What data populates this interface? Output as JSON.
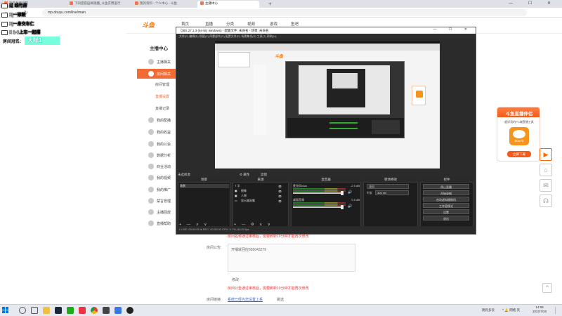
{
  "browser": {
    "tabs": [
      {
        "label": "万斤有悠行院"
      },
      {
        "label": "下同度容园闻观播_斗鱼实用鉴行"
      },
      {
        "label": "我的资料 - 个人中心 - 斗鱼"
      },
      {
        "label": "主播中心"
      }
    ],
    "url": "mp.douyu.com/live/main"
  },
  "overlay": {
    "lines": [
      "过  线竹房",
      "X|一修鼓",
      "X|一身交车仁",
      "X 1-1上车一起摆"
    ],
    "room_label": "房间冠名:",
    "room_value": "大咩1"
  },
  "douyu": {
    "logo": "斗鱼",
    "nav": [
      "首页",
      "直播",
      "分类",
      "视频",
      "游戏",
      "鱼吧"
    ],
    "sidebar_title": "主播中心",
    "sidebar_items": [
      "主播相关",
      "房间相关",
      "我的配播",
      "我的收益",
      "我的公会",
      "数据分析",
      "商业活动",
      "我的视频",
      "我的推广",
      "禁言管理",
      "主播回放",
      "直播帮助"
    ],
    "sidebar_subs": [
      "房间管理",
      "直播设置",
      "直播记录"
    ],
    "content": {
      "warn1": "房间名称通过审核后，需要刷新10分钟才能再次修改",
      "announce_label": "房间公告:",
      "announce_value": "开播就回应655043279",
      "modify": "修改",
      "warn2": "房间公告通过审核后，需要刷新10分钟才能再次修改",
      "loc_label": "房间链接:",
      "loc_value": "系统已经为您设置上系",
      "loc_action": "跳选"
    }
  },
  "ad": {
    "title": "斗鱼直播伴侣",
    "sub": "超好用的PC端直播工具",
    "logo_text": "DOUYU",
    "button": "立即下载"
  },
  "obs": {
    "title": "OBS 27.1.3 (64-bit, windows) - 配置文件: 未命名 - 场景: 未命名",
    "win_buttons": "— ☐ ✕",
    "menu": "文件(F)  编辑(E)  视图(V)  停靠部件(D)  配置文件(P)  场景集合(S)  工具(T)  帮助(H)",
    "no_source": "未选择源",
    "props": "⚙ 属性",
    "filters": "滤镜",
    "docks": {
      "scenes": "场景",
      "sources": "来源",
      "mixer": "混音器",
      "transitions": "转场特效",
      "controls": "控件"
    },
    "scene_item": "场景",
    "sources": [
      "T 字",
      "图像",
      "人物",
      "显示器采集"
    ],
    "mixer": [
      {
        "name": "麦克风/Aux",
        "db": "-2.0 dB"
      },
      {
        "name": "桌面音频",
        "db": "0.0 dB"
      }
    ],
    "transition": {
      "value": "淡出",
      "duration_label": "时长",
      "duration": "300 ms"
    },
    "controls": [
      "停止直播",
      "开始录制",
      "启动虚拟摄像机",
      "工作室模式",
      "设置",
      "退出"
    ],
    "statusbar": "▪ LIVE: 00:00:00   ● REC: 00:00:00   CPU: 0.7%, 60.00 fps",
    "tools_scenes": "+ — ∧ ∨",
    "tools_sources": "+ — ⚙ ∧ ∨"
  },
  "taskbar": {
    "tray": "^ 🔔 网络 英 ",
    "clock_time": "14:58",
    "clock_date": "2022/7/28",
    "weather": "阴有多云"
  }
}
